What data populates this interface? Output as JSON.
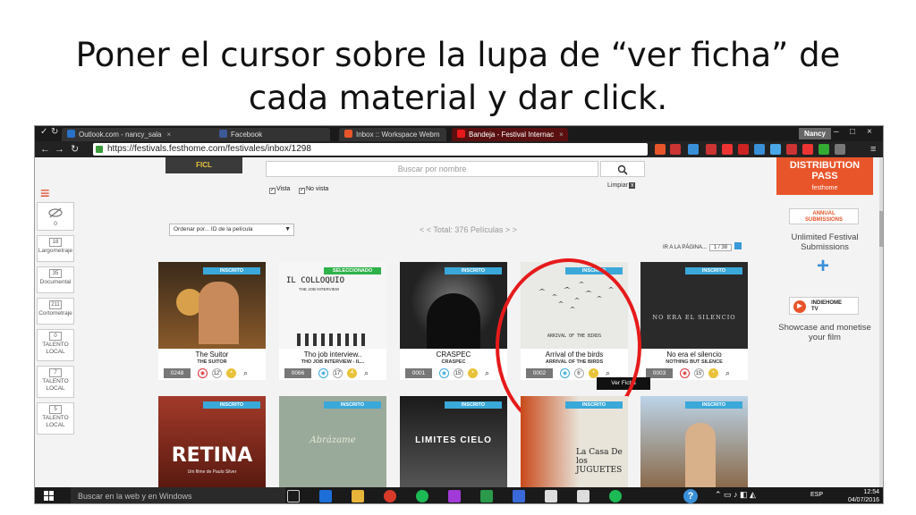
{
  "slide": {
    "title_line1": "Poner el cursor sobre la lupa de “ver ficha” de",
    "title_line2": "cada material y dar click."
  },
  "browser": {
    "tabs": [
      {
        "label": "Outlook.com - nancy_sala"
      },
      {
        "label": "Facebook"
      },
      {
        "label": "Inbox :: Workspace Webm"
      },
      {
        "label": "Bandeja - Festival Internac"
      }
    ],
    "user": "Nancy",
    "url": "https://festivals.festhome.com/festivales/inbox/1298"
  },
  "header": {
    "logo": "FICL",
    "search_placeholder": "Buscar por nombre",
    "filter_vista": "Vista",
    "filter_no_vista": "No vista",
    "clear_label": "Limpiar",
    "clear_icon": "x"
  },
  "sidebar": {
    "menu_icon": "hamburger-icon",
    "items": [
      {
        "count": "0",
        "label": ""
      },
      {
        "count": "18",
        "label": "Largometraje"
      },
      {
        "count": "35",
        "label": "Documental"
      },
      {
        "count": "211",
        "label": "Cortometraje"
      },
      {
        "count": "0",
        "label": "TALENTO LOCAL"
      },
      {
        "count": "7",
        "label": "TALENTO LOCAL"
      },
      {
        "count": "5",
        "label": "TALENTO LOCAL"
      }
    ]
  },
  "toolbar": {
    "order_label": "Ordenar por... ID de la película",
    "total_label": "< < Total: 376 Películas > >",
    "goto_label": "IR A LA PÁGINA...",
    "page_value": "1 / 38"
  },
  "films_row1": [
    {
      "status": "INSCRITO",
      "title": "The Suitor",
      "subtitle": "THE SUITOR",
      "id": "0248",
      "age": "12'"
    },
    {
      "status": "SELECCIONADO",
      "title": "Tho job interview..",
      "subtitle": "THO JOB INTERVIEW - IL...",
      "id": "0066",
      "age": "17'",
      "poster_text": "IL COLLOQUIO",
      "poster_sub": "THE JOB INTERVIEW"
    },
    {
      "status": "INSCRITO",
      "title": "CRASPEC",
      "subtitle": "CRASPEC",
      "id": "0001",
      "age": "15'"
    },
    {
      "status": "INSCRITO",
      "title": "Arrival of the birds",
      "subtitle": "ARRIVAL OF THE BIRDS",
      "id": "0002",
      "age": "6'",
      "poster_text": "ARRIVAL OF THE BIRDS"
    },
    {
      "status": "INSCRITO",
      "title": "No era el silencio",
      "subtitle": "NOTHING BUT SILENCE",
      "id": "0003",
      "age": "15'",
      "poster_text": "NO ERA EL SILENCIO"
    }
  ],
  "films_row2": [
    {
      "status": "INSCRITO",
      "poster_text": "RETINA",
      "poster_sub": "Um filme de Paulo Silver"
    },
    {
      "status": "INSCRITO",
      "poster_text": "Abrázame"
    },
    {
      "status": "INSCRITO",
      "poster_text": "LIMITES CIELO"
    },
    {
      "status": "INSCRITO",
      "poster_text": "La Casa De los JUGUETES"
    },
    {
      "status": "INSCRITO"
    }
  ],
  "tooltip": "Ver Ficha",
  "right_panel": {
    "dist_line1": "DISTRIBUTION",
    "dist_line2": "PASS",
    "dist_brand": "festhome",
    "annual_line1": "ANNUAL",
    "annual_line2": "SUBMISSIONS",
    "unlimited": "Unlimited Festival Submissions",
    "plus": "+",
    "indie_line1": "INDIEHOME",
    "indie_line2": "TV",
    "showcase": "Showcase and monetise your film"
  },
  "taskbar": {
    "search": "Buscar en la web y en Windows",
    "lang": "ESP",
    "time": "12:54",
    "date": "04/07/2016"
  },
  "colors": {
    "accent": "#e8552a",
    "badge_blue": "#3aa8d8",
    "badge_green": "#2fb24a",
    "ring": "#e61a1a"
  }
}
